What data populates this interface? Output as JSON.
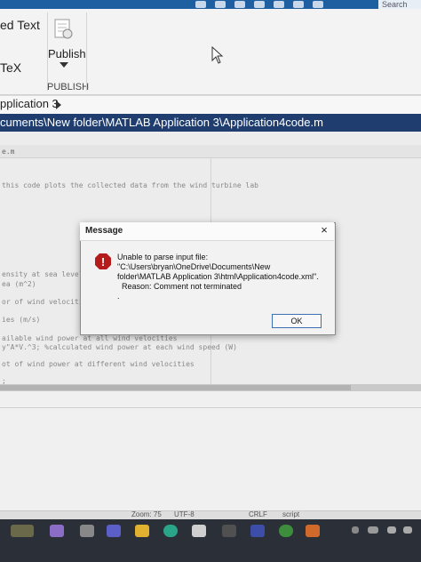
{
  "ribbon": {
    "text1": "ed Text",
    "text2": "TeX",
    "publish_label": "Publish",
    "publish_section": "PUBLISH",
    "search": "Search"
  },
  "breadcrumb": {
    "text": "pplication 3"
  },
  "editor": {
    "title": "cuments\\New folder\\MATLAB Application 3\\Application4code.m",
    "tab": "e.m",
    "lines": [
      "this code plots the collected data from the wind turbine lab",
      "ensity at sea level",
      "ea (m^2)",
      "or of wind velocitie",
      "ies (m/s)",
      "ailable wind power at all wind velocities",
      "y\"A*V.^3; %calculated wind power at each wind speed (W)",
      "ot of wind power at different wind velocities",
      ";"
    ]
  },
  "status": {
    "zoom": "Zoom: 75",
    "encoding": "UTF-8",
    "eol": "CRLF",
    "type": "script"
  },
  "dialog": {
    "title": "Message",
    "close": "×",
    "message_lines": [
      "Unable to parse input file:",
      "\"C:\\Users\\bryan\\OneDrive\\Documents\\New",
      "folder\\MATLAB Application 3\\html\\Application4code.xml\".",
      "  Reason: Comment not terminated",
      "."
    ],
    "ok_label": "OK",
    "error_glyph": "!",
    "icon": "error-icon"
  },
  "colors": {
    "titlebar": "#1f3e6f",
    "error_icon": "#b51b1b",
    "taskbar": "#2b2f38"
  }
}
